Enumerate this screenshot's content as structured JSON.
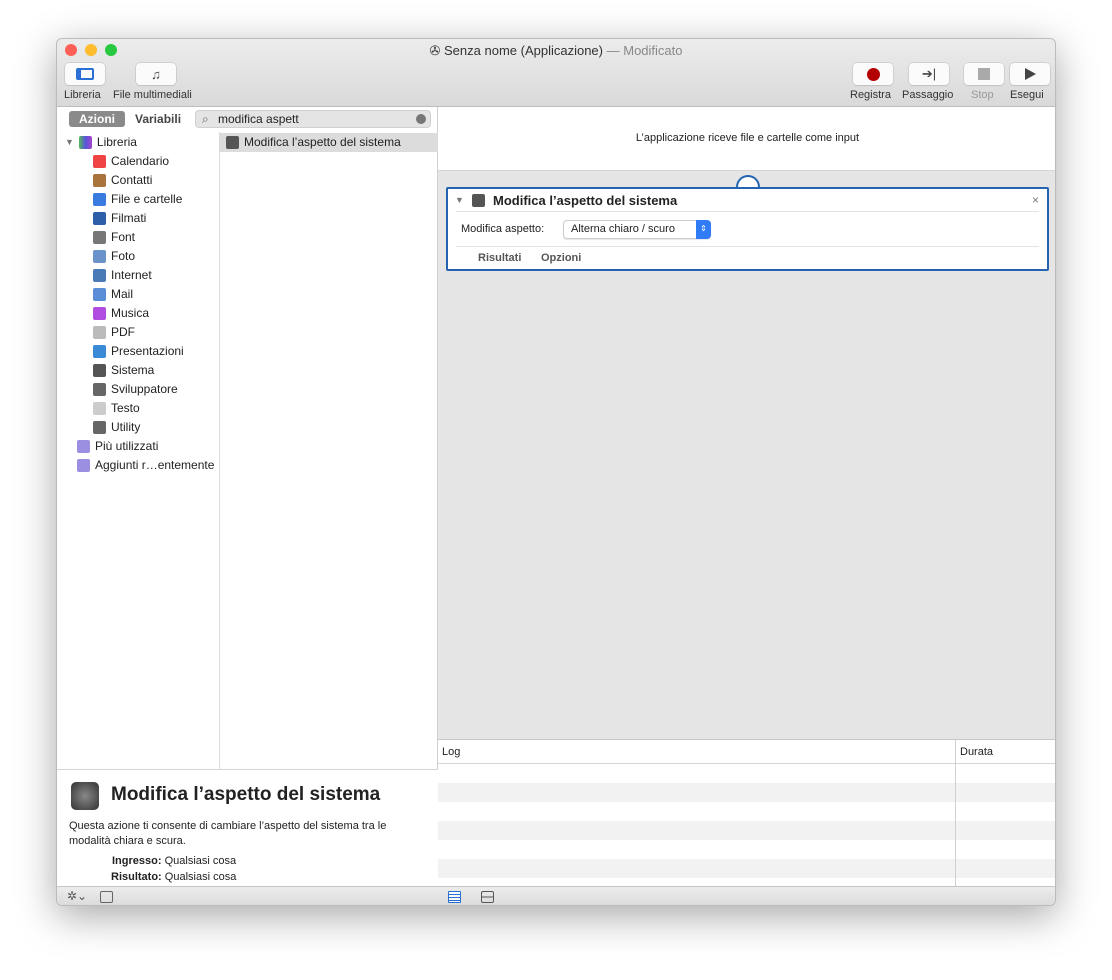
{
  "window": {
    "title": "Senza nome (Applicazione)",
    "title_suffix": "— Modificato"
  },
  "toolbar": {
    "library": "Libreria",
    "media": "File multimediali",
    "record": "Registra",
    "step": "Passaggio",
    "stop": "Stop",
    "run": "Esegui",
    "record_color": "#b30000"
  },
  "tabs": {
    "actions": "Azioni",
    "variables": "Variabili"
  },
  "search": {
    "value": "modifica aspett"
  },
  "library": {
    "root": "Libreria",
    "items": [
      {
        "label": "Calendario",
        "color": "#e44"
      },
      {
        "label": "Contatti",
        "color": "#a9743b"
      },
      {
        "label": "File e cartelle",
        "color": "#3a7be0"
      },
      {
        "label": "Filmati",
        "color": "#2c5fa8"
      },
      {
        "label": "Font",
        "color": "#777"
      },
      {
        "label": "Foto",
        "color": "#6a93c9"
      },
      {
        "label": "Internet",
        "color": "#4a7bb7"
      },
      {
        "label": "Mail",
        "color": "#5a8ed6"
      },
      {
        "label": "Musica",
        "color": "#b04de0"
      },
      {
        "label": "PDF",
        "color": "#bbb"
      },
      {
        "label": "Presentazioni",
        "color": "#3b8ad8"
      },
      {
        "label": "Sistema",
        "color": "#555"
      },
      {
        "label": "Sviluppatore",
        "color": "#666"
      },
      {
        "label": "Testo",
        "color": "#ccc"
      },
      {
        "label": "Utility",
        "color": "#666"
      }
    ],
    "smart": [
      {
        "label": "Più utilizzati"
      },
      {
        "label": "Aggiunti r…entemente"
      }
    ]
  },
  "actions": [
    {
      "label": "Modifica l’aspetto del sistema"
    }
  ],
  "description": {
    "title": "Modifica l’aspetto del sistema",
    "text": "Questa azione ti consente di cambiare l’aspetto del sistema tra le modalità chiara e scura.",
    "input_label": "Ingresso:",
    "input_value": "Qualsiasi cosa",
    "result_label": "Risultato:",
    "result_value": "Qualsiasi cosa"
  },
  "workflow": {
    "header": "L’applicazione riceve file e cartelle come input",
    "action": {
      "title": "Modifica l’aspetto del sistema",
      "field_label": "Modifica aspetto:",
      "field_value": "Alterna chiaro / scuro",
      "results": "Risultati",
      "options": "Opzioni"
    }
  },
  "log": {
    "col_log": "Log",
    "col_duration": "Durata"
  }
}
